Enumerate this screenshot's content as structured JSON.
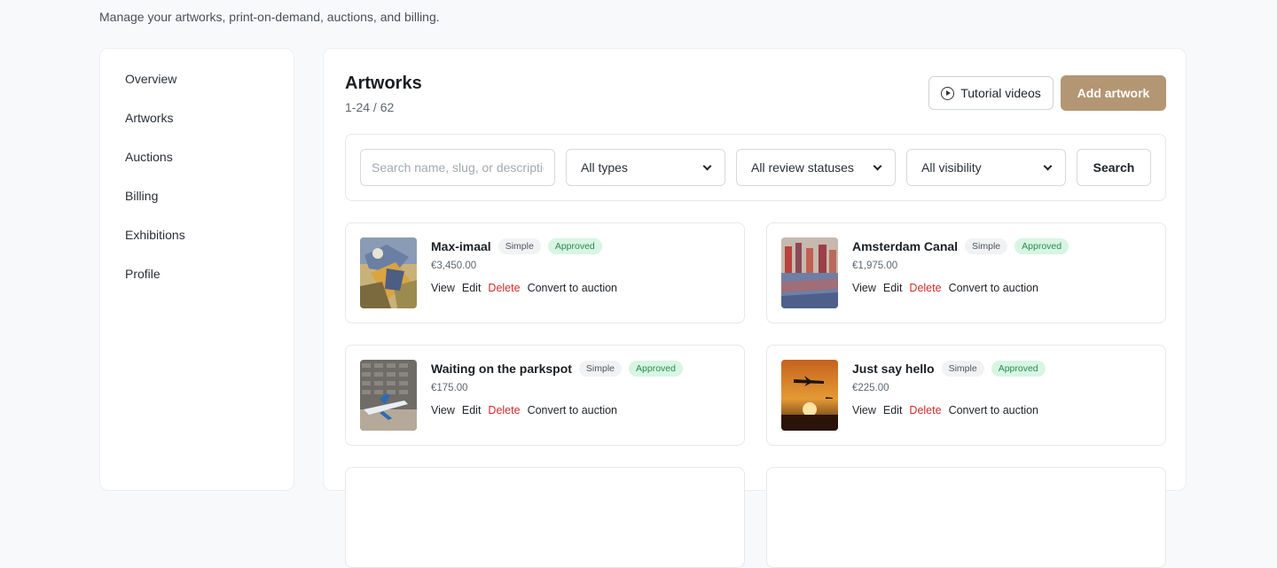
{
  "header": {
    "subtitle": "Manage your artworks, print-on-demand, auctions, and billing."
  },
  "sidebar": {
    "items": [
      {
        "label": "Overview"
      },
      {
        "label": "Artworks"
      },
      {
        "label": "Auctions"
      },
      {
        "label": "Billing"
      },
      {
        "label": "Exhibitions"
      },
      {
        "label": "Profile"
      }
    ]
  },
  "main": {
    "title": "Artworks",
    "count": "1-24 / 62",
    "tutorial_label": "Tutorial videos",
    "add_label": "Add artwork"
  },
  "filters": {
    "search_placeholder": "Search name, slug, or description",
    "type_selected": "All types",
    "review_selected": "All review statuses",
    "visibility_selected": "All visibility",
    "search_button": "Search"
  },
  "artworks": [
    {
      "title": "Max-imaal",
      "type": "Simple",
      "status": "Approved",
      "price": "€3,450.00",
      "view": "View",
      "edit": "Edit",
      "delete": "Delete",
      "convert": "Convert to auction"
    },
    {
      "title": "Amsterdam Canal",
      "type": "Simple",
      "status": "Approved",
      "price": "€1,975.00",
      "view": "View",
      "edit": "Edit",
      "delete": "Delete",
      "convert": "Convert to auction"
    },
    {
      "title": "Waiting on the parkspot",
      "type": "Simple",
      "status": "Approved",
      "price": "€175.00",
      "view": "View",
      "edit": "Edit",
      "delete": "Delete",
      "convert": "Convert to auction"
    },
    {
      "title": "Just say hello",
      "type": "Simple",
      "status": "Approved",
      "price": "€225.00",
      "view": "View",
      "edit": "Edit",
      "delete": "Delete",
      "convert": "Convert to auction"
    }
  ],
  "colors": {
    "accent": "#b39673",
    "delete": "#d12b2b",
    "approved_bg": "#d8f5e3",
    "approved_text": "#2a8a50"
  }
}
